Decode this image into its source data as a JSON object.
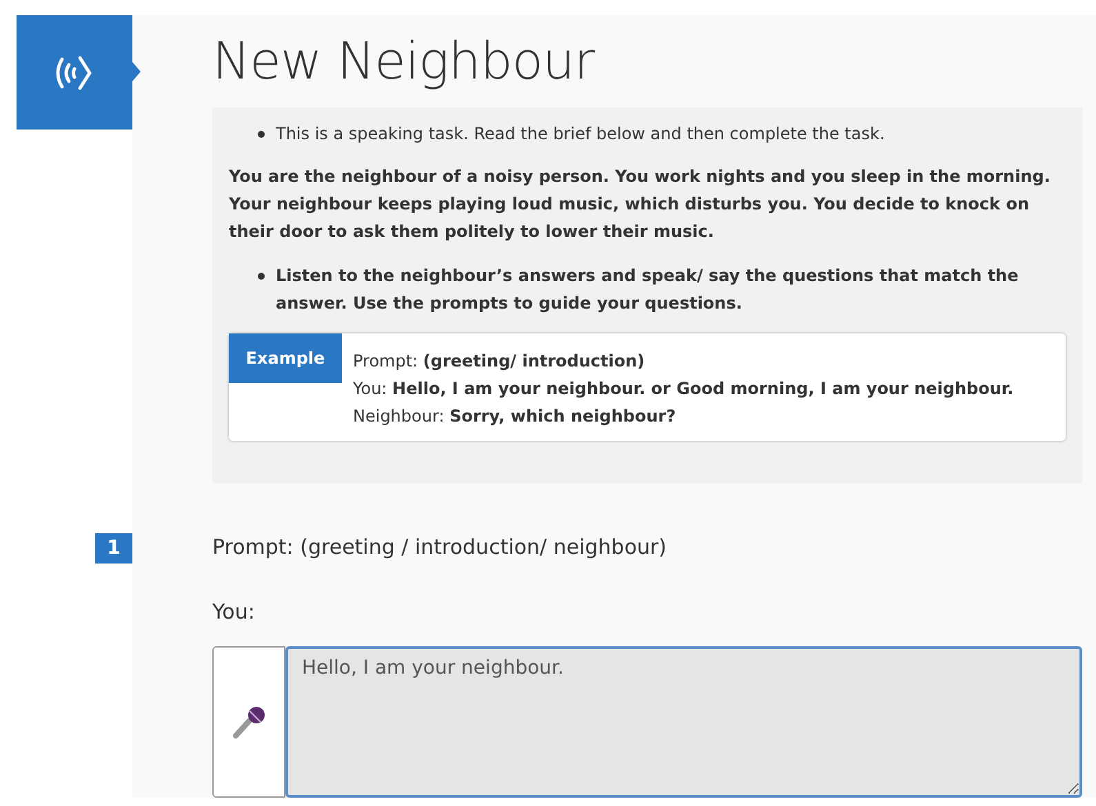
{
  "title": "New Neighbour",
  "instructions": {
    "intro": "This is a speaking task. Read the brief below and then complete the task.",
    "brief": "You are the neighbour of a noisy person. You work nights and you sleep in the morning. Your neighbour keeps playing loud music, which disturbs you. You decide to knock on their door to ask them politely to lower their music.",
    "task": "Listen to the neighbour’s answers and speak/ say the questions that match the answer. Use the prompts to guide your questions.",
    "example": {
      "label": "Example",
      "lines": [
        "Prompt: **(greeting/ introduction)**",
        "You: **Hello, I am your neighbour. or Good morning, I am your neighbour.**",
        "Neighbour: **Sorry, which neighbour?**"
      ]
    }
  },
  "questions": [
    {
      "number": "1",
      "prompt": "Prompt: (greeting / introduction/ neighbour)",
      "answer_label": "You:",
      "answer": "Hello, I am your neighbour."
    }
  ]
}
